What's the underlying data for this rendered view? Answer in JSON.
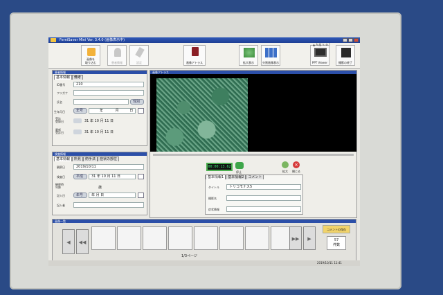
{
  "window": {
    "title": "FerniSaver Mini Ver. 3.4.0 (画像表示中)"
  },
  "toolbar": {
    "import_label": "画像を\n取り込む",
    "patient_label": "患者情報",
    "settings_label": "設定",
    "atlas_label": "画像アトラス",
    "enlarge_label": "拡大表示",
    "multi_label": "分割画像表示",
    "ppt_label": "PPT Viewer",
    "exit_label": "撮影の終了"
  },
  "patient": {
    "header": "患者情報",
    "tabs": [
      "基本情報",
      "備考"
    ],
    "id_label": "ID番号",
    "id_value": "210",
    "kana_label": "フリガナ",
    "kana_value": "",
    "name_label": "氏名",
    "name_value": "",
    "sex_label": "性別",
    "birth_label": "生年月日",
    "era_placeholder": "年号",
    "year_unit": "年",
    "month_unit": "月",
    "day_unit": "日",
    "first_visit_label": "受診\n登録日",
    "first_visit_value": "31 年 10 月 11 日",
    "last_visit_label": "最新\n受診日",
    "last_visit_value": "31 年 10 月 11 日"
  },
  "exam": {
    "header": "検査情報",
    "tabs": [
      "基本情報",
      "所見",
      "術手法",
      "症状の部位"
    ],
    "date_label": "観察日",
    "date_value": "2019/10/11",
    "exam_date_label": "検査日",
    "exam_era": "平成",
    "exam_date_value": "31 年 10 月 11 日",
    "age_label": "観察時\n年齢",
    "age_value": "歳",
    "recorder_label": "記入日",
    "recorder_era": "年号",
    "recorder_value": "年 月 日",
    "writer_label": "記入者",
    "writer_value": ""
  },
  "viewer": {
    "header": "画像アトラス",
    "timer": "00:00:13.62",
    "stop_label": "停止",
    "zoom_label": "拡大",
    "close_label": "閉じる",
    "info_tabs": [
      "基本情報1",
      "基本情報2",
      "コメント"
    ],
    "title_label": "タイトル",
    "title_value": "トリコモナス5",
    "file_label": "撮影名",
    "file_value": "",
    "form_label": "症状情報",
    "form_value": ""
  },
  "filmstrip": {
    "header": "画像一覧",
    "page": "1/3ページ",
    "prev_label": "◀◀",
    "next_label": "▶▶",
    "save_label": "コメントの保存",
    "count_label": "57\n件数"
  },
  "status": {
    "clock": "2019/10/11 11:41"
  }
}
